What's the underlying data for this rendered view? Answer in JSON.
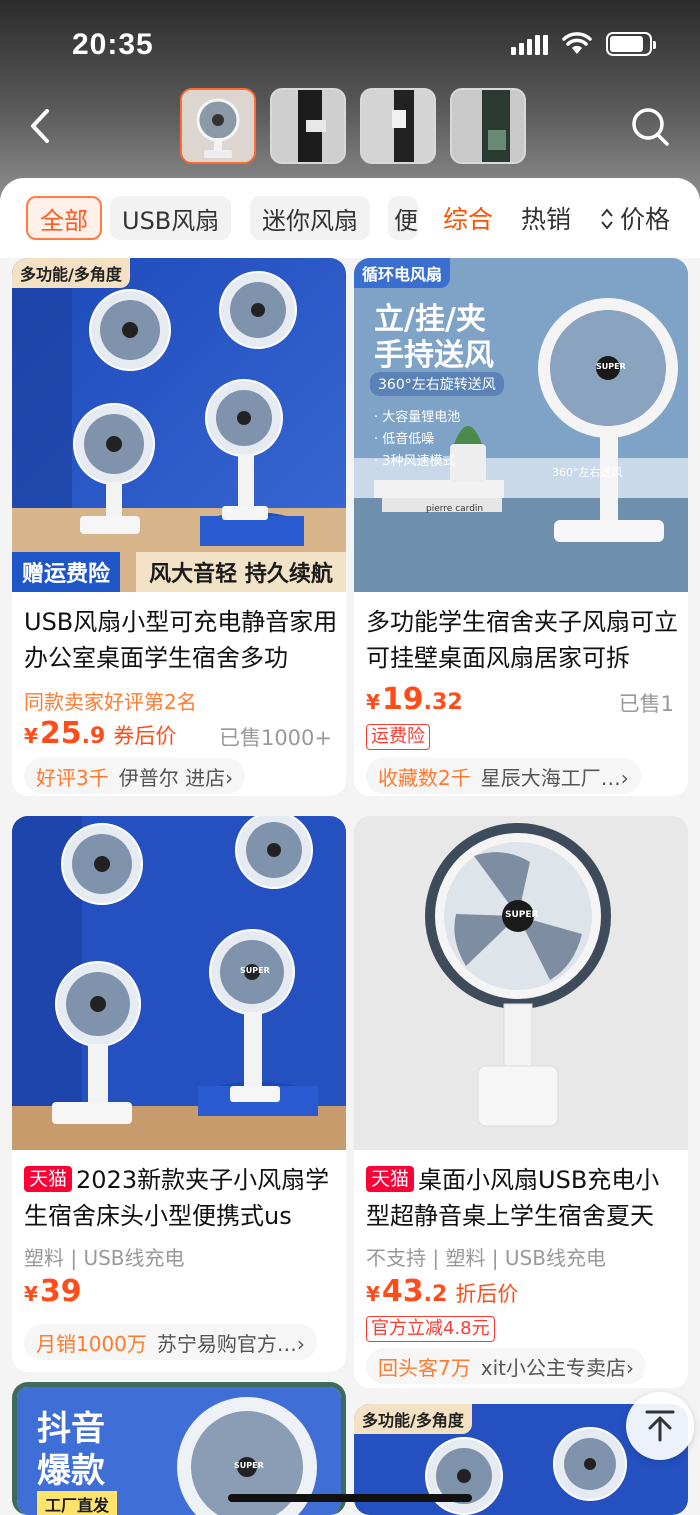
{
  "status_bar": {
    "time": "20:35"
  },
  "filters": {
    "chips": [
      "全部",
      "USB风扇",
      "迷你风扇",
      "便"
    ],
    "sort": [
      "综合",
      "热销",
      "价格"
    ]
  },
  "products": [
    {
      "title": "USB风扇小型可充电静音家用办公室桌面学生宿舍多功",
      "ribbon": "多功能/多角度",
      "promo_left": "赠运费险",
      "promo_right": "风大音轻 持久续航",
      "meta": "同款卖家好评第2名",
      "price_yen": "¥",
      "price_int": "25",
      "price_dec": ".9",
      "price_note": "券后价",
      "sold": "已售1000+",
      "shop_highlight": "好评3千",
      "shop_name": "伊普尔 进店›"
    },
    {
      "title": "多功能学生宿舍夹子风扇可立可挂壁桌面风扇居家可拆",
      "ribbon": "循环电风扇",
      "headline1": "立/挂/夹",
      "headline2": "手持送风",
      "sub": "360°左右旋转送风",
      "bullets": [
        "· 大容量锂电池",
        "· 低音低噪",
        "· 3种风速模式"
      ],
      "badge": "360°左右送风",
      "book_label": "pierre cardin",
      "brand": "SUPER",
      "price_yen": "¥",
      "price_int": "19",
      "price_dec": ".32",
      "sold": "已售1",
      "tag": "运费险",
      "shop_highlight": "收藏数2千",
      "shop_name": "星辰大海工厂…›"
    },
    {
      "badge": "天猫",
      "title": "2023新款夹子小风扇学生宿舍床头小型便携式us",
      "brand": "SUPER",
      "meta": "塑料 | USB线充电",
      "price_yen": "¥",
      "price_int": "39",
      "shop_highlight": "月销1000万",
      "shop_name": "苏宁易购官方…›"
    },
    {
      "badge": "天猫",
      "title": "桌面小风扇USB充电小型超静音桌上学生宿舍夏天",
      "brand": "SUPER",
      "meta": "不支持 | 塑料 | USB线充电",
      "price_yen": "¥",
      "price_int": "43",
      "price_dec": ".2",
      "price_note": "折后价",
      "tag": "官方立减4.8元",
      "shop_highlight": "回头客7万",
      "shop_name": "xit小公主专卖店›"
    },
    {
      "headline1": "抖音",
      "headline2": "爆款",
      "sub": "工厂直发",
      "brand": "SUPER"
    },
    {
      "ribbon": "多功能/多角度"
    }
  ],
  "colors": {
    "accent": "#ff5000",
    "price": "#ff4d1a",
    "tmall": "#ff0036"
  }
}
